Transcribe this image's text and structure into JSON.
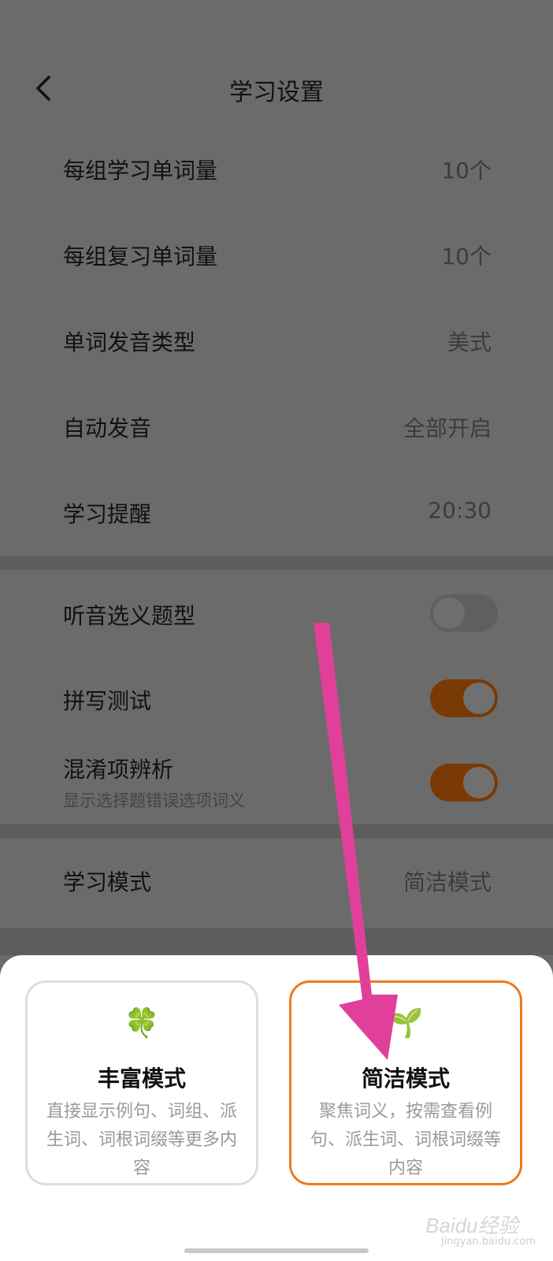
{
  "header": {
    "title": "学习设置"
  },
  "group1": [
    {
      "label": "每组学习单词量",
      "value": "10个"
    },
    {
      "label": "每组复习单词量",
      "value": "10个"
    },
    {
      "label": "单词发音类型",
      "value": "美式"
    },
    {
      "label": "自动发音",
      "value": "全部开启"
    },
    {
      "label": "学习提醒",
      "value": "20:30"
    }
  ],
  "group2": [
    {
      "label": "听音选义题型",
      "sub": "",
      "toggle": "off"
    },
    {
      "label": "拼写测试",
      "sub": "",
      "toggle": "on"
    },
    {
      "label": "混淆项辨析",
      "sub": "显示选择题错误选项词义",
      "toggle": "on"
    }
  ],
  "group3": {
    "label": "学习模式",
    "value": "简洁模式"
  },
  "sheet": {
    "rich": {
      "icon": "🍀",
      "title": "丰富模式",
      "desc": "直接显示例句、词组、派生词、词根词缀等更多内容"
    },
    "simple": {
      "icon": "🌱",
      "title": "简洁模式",
      "desc": "聚焦词义，按需查看例句、派生词、词根词缀等内容"
    }
  },
  "watermark": {
    "text": "Baidu经验",
    "sub": "jingyan.baidu.com"
  },
  "colors": {
    "accent": "#ee7a1a",
    "toggle_on": "#7a3a05",
    "annotation_arrow": "#e0409a"
  },
  "icons": {
    "back": "chevron-left-icon",
    "rich": "clover-icon",
    "simple": "seedling-icon"
  }
}
